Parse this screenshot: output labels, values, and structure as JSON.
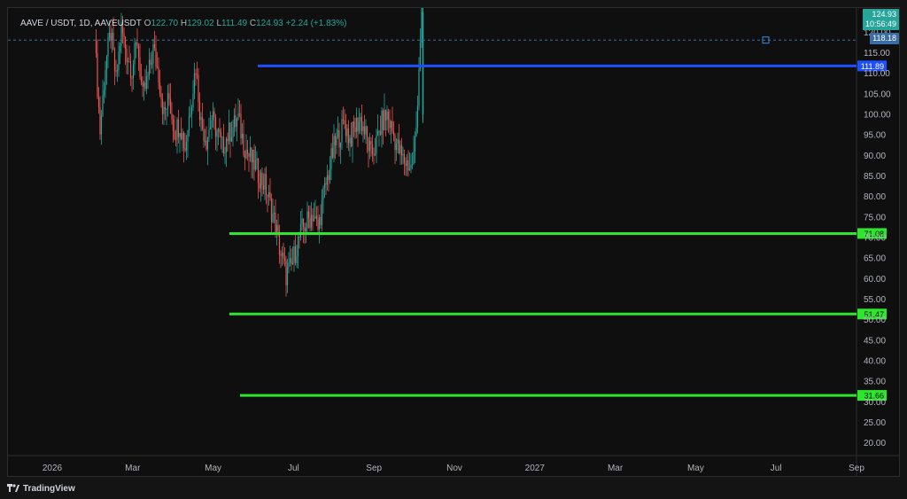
{
  "legend": {
    "symbol": "AAVE / USDT, 1D, AAVEUSDT",
    "o_label": "O",
    "o_value": "122.70",
    "h_label": "H",
    "h_value": "129.02",
    "l_label": "L",
    "l_value": "111.49",
    "c_label": "C",
    "c_value": "124.93",
    "change": "+2.24 (+1.83%)"
  },
  "price_axis": {
    "labels": [
      "120.00",
      "115.00",
      "110.00",
      "105.00",
      "100.00",
      "95.00",
      "90.00",
      "85.00",
      "80.00",
      "75.00",
      "70.00",
      "65.00",
      "60.00",
      "55.00",
      "50.00",
      "45.00",
      "40.00",
      "35.00",
      "30.00",
      "25.00",
      "20.00"
    ]
  },
  "time_axis": {
    "labels": [
      "2026",
      "Mar",
      "May",
      "Jul",
      "Sep",
      "Nov",
      "2027",
      "Mar",
      "May",
      "Jul",
      "Sep"
    ]
  },
  "current_price": {
    "value": "124.93",
    "countdown": "10:56:49",
    "color": "#26a69a"
  },
  "crosshair_price": {
    "value": "118.18",
    "color": "#3a6ea5"
  },
  "horizontal_lines": [
    {
      "value": 111.89,
      "label": "111.89",
      "color": "#1e4fff"
    },
    {
      "value": 71.08,
      "label": "71.08",
      "color": "#2ee62e"
    },
    {
      "value": 51.47,
      "label": "51.47",
      "color": "#2ee62e"
    },
    {
      "value": 31.66,
      "label": "31.66",
      "color": "#2ee62e"
    }
  ],
  "colors": {
    "up": "#26a69a",
    "down": "#ef5350",
    "background": "#0f0f0f"
  },
  "footer": {
    "brand": "TradingView"
  },
  "chart_data": {
    "type": "candlestick",
    "symbol": "AAVEUSDT",
    "interval": "1D",
    "ylim": [
      17,
      126
    ],
    "price_path": [
      [
        0,
        118
      ],
      [
        4,
        96
      ],
      [
        8,
        112
      ],
      [
        12,
        120
      ],
      [
        16,
        108
      ],
      [
        20,
        121
      ],
      [
        24,
        115
      ],
      [
        28,
        111
      ],
      [
        32,
        118
      ],
      [
        36,
        104
      ],
      [
        40,
        109
      ],
      [
        44,
        116
      ],
      [
        48,
        110
      ],
      [
        52,
        100
      ],
      [
        56,
        104
      ],
      [
        60,
        96
      ],
      [
        64,
        98
      ],
      [
        68,
        92
      ],
      [
        72,
        102
      ],
      [
        76,
        112
      ],
      [
        80,
        98
      ],
      [
        84,
        94
      ],
      [
        88,
        99
      ],
      [
        92,
        96
      ],
      [
        96,
        92
      ],
      [
        100,
        95
      ],
      [
        104,
        97
      ],
      [
        108,
        99
      ],
      [
        112,
        93
      ],
      [
        116,
        90
      ],
      [
        120,
        88
      ],
      [
        124,
        85
      ],
      [
        128,
        83
      ],
      [
        132,
        78
      ],
      [
        136,
        73
      ],
      [
        140,
        66
      ],
      [
        144,
        61
      ],
      [
        148,
        63
      ],
      [
        152,
        68
      ],
      [
        156,
        72
      ],
      [
        160,
        74
      ],
      [
        164,
        76
      ],
      [
        168,
        72
      ],
      [
        172,
        80
      ],
      [
        176,
        86
      ],
      [
        180,
        92
      ],
      [
        184,
        95
      ],
      [
        188,
        98
      ],
      [
        192,
        94
      ],
      [
        196,
        97
      ],
      [
        200,
        99
      ],
      [
        204,
        95
      ],
      [
        208,
        90
      ],
      [
        212,
        93
      ],
      [
        216,
        98
      ],
      [
        220,
        100
      ],
      [
        224,
        96
      ],
      [
        228,
        92
      ],
      [
        232,
        89
      ],
      [
        236,
        88
      ],
      [
        238,
        87
      ],
      [
        240,
        90
      ],
      [
        242,
        97
      ],
      [
        244,
        112
      ],
      [
        246,
        125
      ]
    ]
  }
}
